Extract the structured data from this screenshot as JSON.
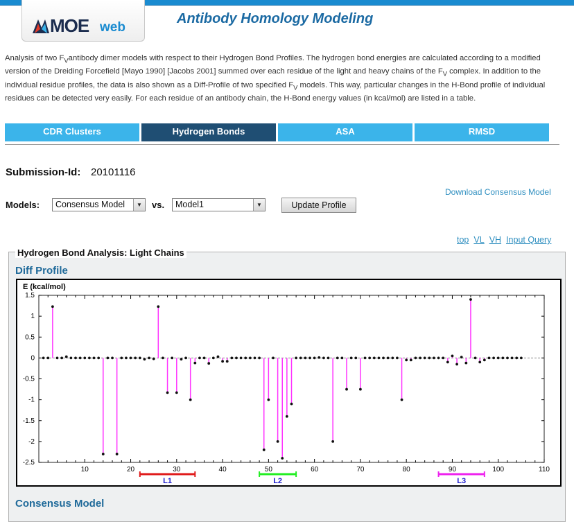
{
  "header": {
    "logo_text_main": "MOE",
    "logo_text_suffix": "web",
    "page_title": "Antibody Homology Modeling"
  },
  "intro": {
    "p1": "Analysis of two F",
    "sub1": "V",
    "p2": "antibody dimer models with respect to their Hydrogen Bond Profiles. The hydrogen bond energies are calculated according to a modified version of the Dreiding Forcefield [Mayo 1990] [Jacobs 2001] summed over each residue of the light and heavy chains of the F",
    "sub2": "V",
    "p3": " complex. In addition to the individual residue profiles, the data is also shown as a Diff-Profile of two specified F",
    "sub3": "V",
    "p4": " models. This way, particular changes in the H-Bond profile of individual residues can be detected very easily. For each residue of an antibody chain, the H-Bond energy values (in kcal/mol) are listed in a table."
  },
  "tabs": [
    {
      "label": "CDR Clusters",
      "active": false
    },
    {
      "label": "Hydrogen Bonds",
      "active": true
    },
    {
      "label": "ASA",
      "active": false
    },
    {
      "label": "RMSD",
      "active": false
    }
  ],
  "submission": {
    "label": "Submission-Id:",
    "value": "20101116"
  },
  "download_link": "Download Consensus Model",
  "models": {
    "label": "Models:",
    "left_selected": "Consensus Model",
    "vs_label": "vs.",
    "right_selected": "Model1",
    "update_label": "Update Profile"
  },
  "nav_links": [
    "top",
    "VL",
    "VH",
    "Input Query"
  ],
  "panel": {
    "legend": "Hydrogen Bond Analysis: Light Chains",
    "diff_title": "Diff Profile",
    "consensus_title": "Consensus Model"
  },
  "colors": {
    "stem": "#ff33ff",
    "L1": "#e01b1b",
    "L2": "#22ee22",
    "L3": "#ee22ee",
    "region_label": "#1a1acc"
  },
  "chart_data": {
    "type": "stem",
    "ylabel": "E (kcal/mol)",
    "xlim": [
      0,
      110
    ],
    "ylim": [
      -2.5,
      1.5
    ],
    "xticks": [
      10,
      20,
      30,
      40,
      50,
      60,
      70,
      80,
      90,
      100,
      110
    ],
    "yticks": [
      1.5,
      1,
      0.5,
      0,
      -0.5,
      -1,
      -1.5,
      -2,
      -2.5
    ],
    "x": [
      1,
      2,
      3,
      4,
      5,
      6,
      7,
      8,
      9,
      10,
      11,
      12,
      13,
      14,
      15,
      16,
      17,
      18,
      19,
      20,
      21,
      22,
      23,
      24,
      25,
      26,
      27,
      28,
      29,
      30,
      31,
      32,
      33,
      34,
      35,
      36,
      37,
      38,
      39,
      40,
      41,
      42,
      43,
      44,
      45,
      46,
      47,
      48,
      49,
      50,
      51,
      52,
      53,
      54,
      55,
      56,
      57,
      58,
      59,
      60,
      61,
      62,
      63,
      64,
      65,
      66,
      67,
      68,
      69,
      70,
      71,
      72,
      73,
      74,
      75,
      76,
      77,
      78,
      79,
      80,
      81,
      82,
      83,
      84,
      85,
      86,
      87,
      88,
      89,
      90,
      91,
      92,
      93,
      94,
      95,
      96,
      97,
      98,
      99,
      100,
      101,
      102,
      103,
      104,
      105
    ],
    "y": [
      0,
      0,
      1.23,
      0,
      0,
      0.03,
      0,
      0,
      0,
      0,
      0,
      0,
      0,
      -2.3,
      0,
      0,
      -2.3,
      0,
      0,
      0,
      0,
      0,
      -0.03,
      0,
      -0.02,
      1.23,
      0,
      -0.83,
      0,
      -0.83,
      -0.03,
      0,
      -1.0,
      -0.12,
      0,
      0,
      -0.13,
      0,
      0.03,
      -0.08,
      -0.08,
      0,
      0,
      0,
      0,
      0,
      0,
      0,
      -2.2,
      -1.0,
      0,
      -2.0,
      -2.4,
      -1.4,
      -1.1,
      0,
      0,
      0,
      0,
      0,
      0.01,
      0,
      0,
      -2.0,
      0,
      0,
      -0.75,
      0,
      0,
      -0.75,
      0,
      0,
      0,
      0,
      0,
      0,
      0,
      0,
      -1.0,
      -0.05,
      -0.05,
      0,
      0,
      0,
      0,
      0,
      0,
      0,
      -0.1,
      0.05,
      -0.15,
      0.02,
      -0.12,
      1.4,
      0,
      -0.1,
      -0.05,
      0,
      0,
      0,
      0,
      0,
      0,
      0,
      0
    ],
    "regions": [
      {
        "label": "L1",
        "start": 22,
        "end": 34
      },
      {
        "label": "L2",
        "start": 48,
        "end": 56
      },
      {
        "label": "L3",
        "start": 87,
        "end": 97
      }
    ]
  }
}
